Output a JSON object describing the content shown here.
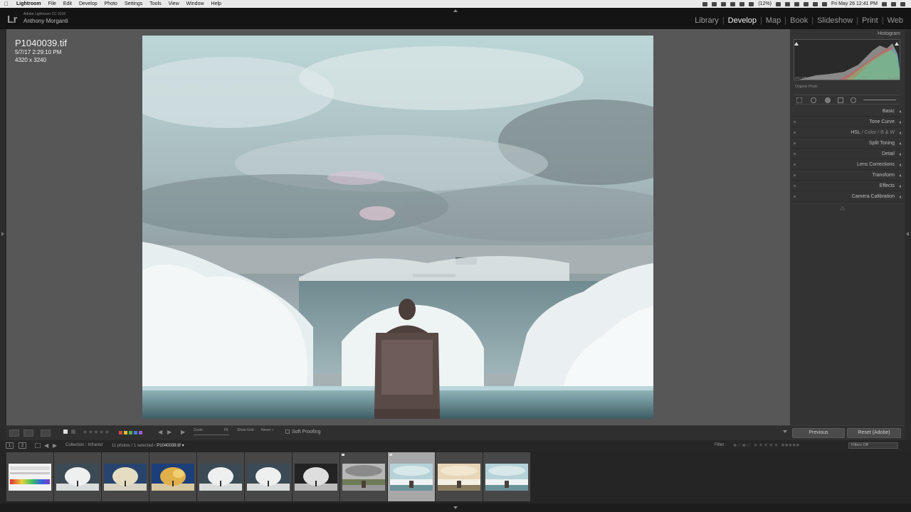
{
  "menubar": {
    "items": [
      "Lightroom",
      "File",
      "Edit",
      "Develop",
      "Photo",
      "Settings",
      "Tools",
      "View",
      "Window",
      "Help"
    ],
    "battery": "(12%)",
    "clock": "Fri May 26  12:41 PM"
  },
  "identity": {
    "logo": "Lr",
    "version": "Adobe Lightroom CC 2015",
    "user": "Anthony Morganti"
  },
  "modules": [
    {
      "label": "Library",
      "active": false
    },
    {
      "label": "Develop",
      "active": true
    },
    {
      "label": "Map",
      "active": false
    },
    {
      "label": "Book",
      "active": false
    },
    {
      "label": "Slideshow",
      "active": false
    },
    {
      "label": "Print",
      "active": false
    },
    {
      "label": "Web",
      "active": false
    }
  ],
  "photo_info": {
    "filename": "P1040039.tif",
    "date": "5/7/17 2:29:10 PM",
    "dimensions": "4320 x 3240"
  },
  "toolbar": {
    "zoom_label": "Zoom",
    "zoom_value": "Fit",
    "grid_label": "Show Grid :",
    "grid_value": "Never ÷",
    "soft_proofing": "Soft Proofing",
    "rating": 0,
    "stars": "★★★★★",
    "color_labels": [
      "#d24a4a",
      "#d8c13c",
      "#56b04f",
      "#4c7fd6",
      "#9a5fd0"
    ]
  },
  "right_panel": {
    "histogram_title": "Histogram",
    "hist_meta": [
      "ISO 100",
      "4.5 mm",
      "ƒ / 3.1",
      "¹⁄₂₅₀ sec"
    ],
    "original_photo": "Original Photo",
    "panels": [
      "Basic",
      "Tone Curve",
      "HSL / Color / B & W",
      "Split Toning",
      "Detail",
      "Lens Corrections",
      "Transform",
      "Effects",
      "Camera Calibration"
    ],
    "hsl_parts": [
      "HSL",
      "Color",
      "B & W"
    ],
    "panel_end": "⁂",
    "previous_button": "Previous",
    "reset_button": "Reset (Adobe)"
  },
  "filmstrip": {
    "monitor_1": "1",
    "monitor_2": "2",
    "source": "Collection : Infrared",
    "count": "11 photos / 1 selected /",
    "selected_file": "P1040039.tif ▾",
    "filter_label": "Filter :",
    "filter_value": "Filters Off",
    "thumbnails": [
      {
        "kind": "spectrum",
        "selected": false
      },
      {
        "kind": "tree-bw",
        "selected": false
      },
      {
        "kind": "tree-blue-warm",
        "selected": false
      },
      {
        "kind": "tree-gold",
        "selected": false
      },
      {
        "kind": "tree-bw",
        "selected": false
      },
      {
        "kind": "tree-bw",
        "selected": false
      },
      {
        "kind": "tree-dark",
        "selected": false
      },
      {
        "kind": "scene-gray",
        "selected": false
      },
      {
        "kind": "scene-cyan",
        "selected": true
      },
      {
        "kind": "scene-warm",
        "selected": false
      },
      {
        "kind": "scene-cyan",
        "selected": false
      }
    ]
  }
}
